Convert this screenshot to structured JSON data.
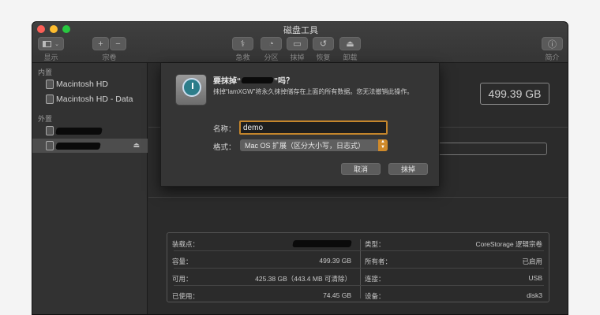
{
  "window": {
    "title": "磁盘工具"
  },
  "toolbar": {
    "view_label": "显示",
    "volume_label": "宗卷",
    "rescue_label": "急救",
    "partition_label": "分区",
    "erase_label": "抹掉",
    "restore_label": "恢复",
    "unmount_label": "卸载",
    "info_label": "简介",
    "add_symbol": "+",
    "remove_symbol": "−"
  },
  "sidebar": {
    "internal_header": "内置",
    "external_header": "外置",
    "internal_items": [
      {
        "label": "Macintosh HD"
      },
      {
        "label": "Macintosh HD - Data"
      }
    ]
  },
  "main": {
    "capacity_display": "499.39 GB"
  },
  "info": {
    "left": [
      {
        "label": "装载点：",
        "value": ""
      },
      {
        "label": "容量：",
        "value": "499.39 GB"
      },
      {
        "label": "可用：",
        "value": "425.38 GB（443.4 MB 可清除）"
      },
      {
        "label": "已使用：",
        "value": "74.45 GB"
      }
    ],
    "right": [
      {
        "label": "类型：",
        "value": "CoreStorage 逻辑宗卷"
      },
      {
        "label": "所有者：",
        "value": "已启用"
      },
      {
        "label": "连接：",
        "value": "USB"
      },
      {
        "label": "设备：",
        "value": "disk3"
      }
    ]
  },
  "dialog": {
    "title_prefix": "要抹掉“",
    "title_suffix": "”吗？",
    "message": "抹掉“lamXGW”将永久抹掉储存在上面的所有数据。您无法撤销此操作。",
    "name_label": "名称：",
    "name_value": "demo",
    "format_label": "格式：",
    "format_value": "Mac OS 扩展（区分大小写，日志式）",
    "cancel_label": "取消",
    "erase_label": "抹掉"
  }
}
